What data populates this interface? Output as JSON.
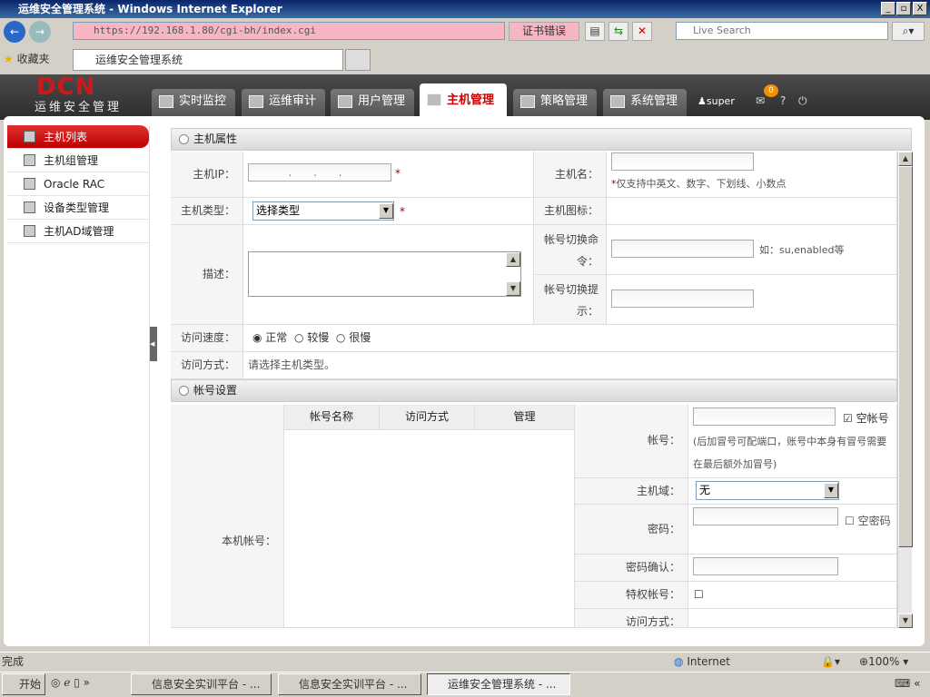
{
  "window": {
    "title": "运维安全管理系统 - Windows Internet Explorer",
    "min": "_",
    "max": "▫",
    "close": "X"
  },
  "browser": {
    "url": "https://192.168.1.80/cgi-bh/index.cgi",
    "cert_error": "证书错误",
    "search_placeholder": "Live Search",
    "favorites": "收藏夹",
    "tab_title": "运维安全管理系统"
  },
  "app": {
    "logo": "DCN",
    "logo_sub": "运维安全管理",
    "nav": [
      {
        "label": "实时监控"
      },
      {
        "label": "运维审计"
      },
      {
        "label": "用户管理"
      },
      {
        "label": "主机管理",
        "active": true
      },
      {
        "label": "策略管理"
      },
      {
        "label": "系统管理"
      }
    ],
    "user": "super",
    "mail_count": "0",
    "help": "?",
    "logout": "⏻"
  },
  "sidebar": {
    "items": [
      {
        "label": "主机列表",
        "active": true
      },
      {
        "label": "主机组管理"
      },
      {
        "label": "Oracle RAC"
      },
      {
        "label": "设备类型管理"
      },
      {
        "label": "主机AD域管理"
      }
    ]
  },
  "host_props": {
    "title": "主机属性",
    "ip_label": "主机IP：",
    "ip_value": ". . .",
    "required": "*",
    "name_label": "主机名：",
    "name_hint": "仅支持中英文、数字、下划线、小数点",
    "type_label": "主机类型：",
    "type_value": "选择类型",
    "icon_label": "主机图标：",
    "desc_label": "描述：",
    "switch_cmd_label": "帐号切换命令：",
    "switch_cmd_hint": "如：su,enabled等",
    "switch_prompt_label": "帐号切换提示：",
    "speed_label": "访问速度：",
    "speed_options": [
      "正常",
      "较慢",
      "很慢"
    ],
    "access_label": "访问方式：",
    "access_value": "请选择主机类型。"
  },
  "account": {
    "title": "帐号设置",
    "local_label": "本机帐号：",
    "columns": [
      "帐号名称",
      "访问方式",
      "管理"
    ],
    "account_label": "帐号：",
    "empty_account": "空帐号",
    "account_hint": "(后加冒号可配端口，账号中本身有冒号需要在最后额外加冒号)",
    "domain_label": "主机域：",
    "domain_value": "无",
    "password_label": "密码：",
    "empty_password": "空密码",
    "confirm_label": "密码确认：",
    "privileged_label": "特权帐号：",
    "access_label": "访问方式："
  },
  "status": {
    "text": "完成",
    "zone": "Internet",
    "zoom": "100%"
  },
  "taskbar": {
    "start": "开始",
    "tasks": [
      "信息安全实训平台 - ...",
      "信息安全实训平台 - ...",
      "运维安全管理系统 - ..."
    ]
  }
}
